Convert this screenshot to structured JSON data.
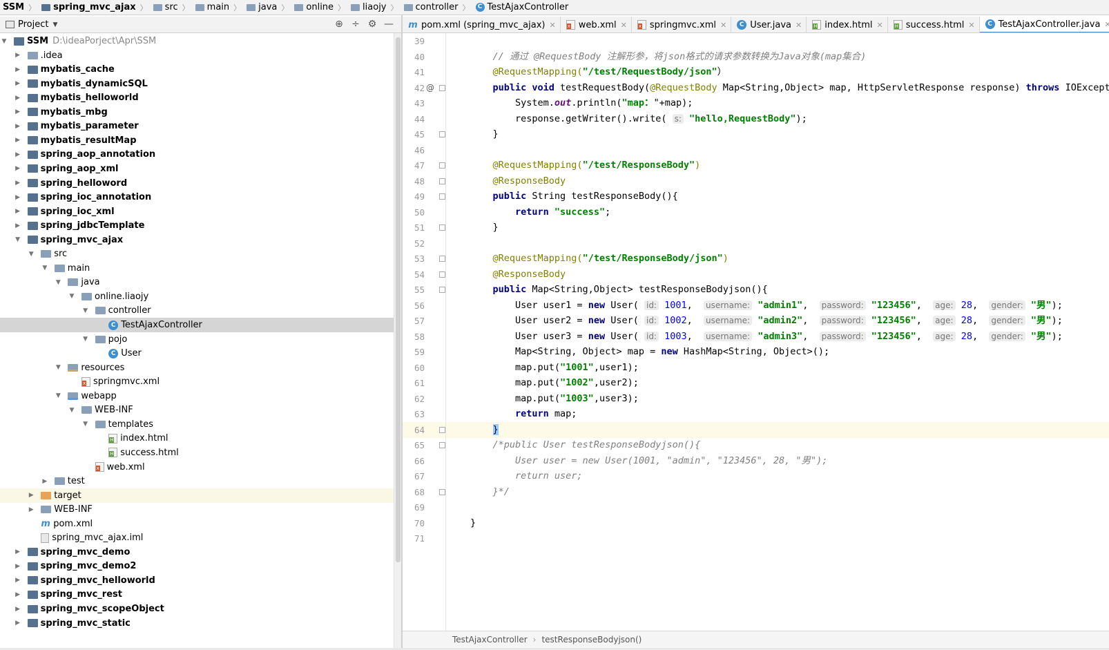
{
  "navbar": {
    "crumbs": [
      {
        "label": "SSM",
        "bold": true,
        "icon": "none"
      },
      {
        "label": "spring_mvc_ajax",
        "bold": true,
        "icon": "module"
      },
      {
        "label": "src",
        "icon": "folder"
      },
      {
        "label": "main",
        "icon": "folder"
      },
      {
        "label": "java",
        "icon": "folder"
      },
      {
        "label": "online",
        "icon": "folder"
      },
      {
        "label": "liaojy",
        "icon": "folder"
      },
      {
        "label": "controller",
        "icon": "folder"
      },
      {
        "label": "TestAjaxController",
        "icon": "class"
      }
    ]
  },
  "project": {
    "title": "Project",
    "tools": [
      "⊕",
      "÷",
      "⚙",
      "—"
    ]
  },
  "tree": [
    {
      "depth": 0,
      "arrow": "open",
      "icon": "module",
      "label": "SSM",
      "bold": true,
      "path": "D:\\ideaPorject\\Apr\\SSM"
    },
    {
      "depth": 1,
      "arrow": "closed",
      "icon": "folder",
      "label": ".idea"
    },
    {
      "depth": 1,
      "arrow": "closed",
      "icon": "module",
      "label": "mybatis_cache",
      "bold": true
    },
    {
      "depth": 1,
      "arrow": "closed",
      "icon": "module",
      "label": "mybatis_dynamicSQL",
      "bold": true
    },
    {
      "depth": 1,
      "arrow": "closed",
      "icon": "module",
      "label": "mybatis_helloworld",
      "bold": true
    },
    {
      "depth": 1,
      "arrow": "closed",
      "icon": "module",
      "label": "mybatis_mbg",
      "bold": true
    },
    {
      "depth": 1,
      "arrow": "closed",
      "icon": "module",
      "label": "mybatis_parameter",
      "bold": true
    },
    {
      "depth": 1,
      "arrow": "closed",
      "icon": "module",
      "label": "mybatis_resultMap",
      "bold": true
    },
    {
      "depth": 1,
      "arrow": "closed",
      "icon": "module",
      "label": "spring_aop_annotation",
      "bold": true
    },
    {
      "depth": 1,
      "arrow": "closed",
      "icon": "module",
      "label": "spring_aop_xml",
      "bold": true
    },
    {
      "depth": 1,
      "arrow": "closed",
      "icon": "module",
      "label": "spring_helloword",
      "bold": true
    },
    {
      "depth": 1,
      "arrow": "closed",
      "icon": "module",
      "label": "spring_ioc_annotation",
      "bold": true
    },
    {
      "depth": 1,
      "arrow": "closed",
      "icon": "module",
      "label": "spring_ioc_xml",
      "bold": true
    },
    {
      "depth": 1,
      "arrow": "closed",
      "icon": "module",
      "label": "spring_jdbcTemplate",
      "bold": true
    },
    {
      "depth": 1,
      "arrow": "open",
      "icon": "module",
      "label": "spring_mvc_ajax",
      "bold": true
    },
    {
      "depth": 2,
      "arrow": "open",
      "icon": "folder",
      "label": "src"
    },
    {
      "depth": 3,
      "arrow": "open",
      "icon": "folder",
      "label": "main"
    },
    {
      "depth": 4,
      "arrow": "open",
      "icon": "folder",
      "label": "java"
    },
    {
      "depth": 5,
      "arrow": "open",
      "icon": "folder",
      "label": "online.liaojy"
    },
    {
      "depth": 6,
      "arrow": "open",
      "icon": "folder",
      "label": "controller"
    },
    {
      "depth": 7,
      "arrow": "none",
      "icon": "class",
      "label": "TestAjaxController",
      "selected": true
    },
    {
      "depth": 6,
      "arrow": "open",
      "icon": "folder",
      "label": "pojo"
    },
    {
      "depth": 7,
      "arrow": "none",
      "icon": "class",
      "label": "User"
    },
    {
      "depth": 4,
      "arrow": "open",
      "icon": "res",
      "label": "resources"
    },
    {
      "depth": 5,
      "arrow": "none",
      "icon": "xml",
      "label": "springmvc.xml"
    },
    {
      "depth": 4,
      "arrow": "open",
      "icon": "web",
      "label": "webapp"
    },
    {
      "depth": 5,
      "arrow": "open",
      "icon": "folder",
      "label": "WEB-INF"
    },
    {
      "depth": 6,
      "arrow": "open",
      "icon": "folder",
      "label": "templates"
    },
    {
      "depth": 7,
      "arrow": "none",
      "icon": "html",
      "label": "index.html"
    },
    {
      "depth": 7,
      "arrow": "none",
      "icon": "html",
      "label": "success.html"
    },
    {
      "depth": 6,
      "arrow": "none",
      "icon": "xml",
      "label": "web.xml"
    },
    {
      "depth": 3,
      "arrow": "closed",
      "icon": "folder",
      "label": "test"
    },
    {
      "depth": 2,
      "arrow": "closed",
      "icon": "target",
      "label": "target",
      "highlight": true
    },
    {
      "depth": 2,
      "arrow": "closed",
      "icon": "folder",
      "label": "WEB-INF"
    },
    {
      "depth": 2,
      "arrow": "none",
      "icon": "mvn",
      "label": "pom.xml"
    },
    {
      "depth": 2,
      "arrow": "none",
      "icon": "iml",
      "label": "spring_mvc_ajax.iml"
    },
    {
      "depth": 1,
      "arrow": "closed",
      "icon": "module",
      "label": "spring_mvc_demo",
      "bold": true
    },
    {
      "depth": 1,
      "arrow": "closed",
      "icon": "module",
      "label": "spring_mvc_demo2",
      "bold": true
    },
    {
      "depth": 1,
      "arrow": "closed",
      "icon": "module",
      "label": "spring_mvc_helloworld",
      "bold": true
    },
    {
      "depth": 1,
      "arrow": "closed",
      "icon": "module",
      "label": "spring_mvc_rest",
      "bold": true
    },
    {
      "depth": 1,
      "arrow": "closed",
      "icon": "module",
      "label": "spring_mvc_scopeObject",
      "bold": true
    },
    {
      "depth": 1,
      "arrow": "closed",
      "icon": "module",
      "label": "spring_mvc_static",
      "bold": true
    }
  ],
  "tabs": [
    {
      "label": "pom.xml (spring_mvc_ajax)",
      "icon": "mvn"
    },
    {
      "label": "web.xml",
      "icon": "xml"
    },
    {
      "label": "springmvc.xml",
      "icon": "xml"
    },
    {
      "label": "User.java",
      "icon": "class"
    },
    {
      "label": "index.html",
      "icon": "html"
    },
    {
      "label": "success.html",
      "icon": "html"
    },
    {
      "label": "TestAjaxController.java",
      "icon": "class",
      "active": true
    }
  ],
  "code": [
    {
      "n": "39",
      "t": []
    },
    {
      "n": "40",
      "t": [
        [
          "cm",
          "    // 通过 @RequestBody 注解形参，将json格式的请求参数转换为Java对象(map集合)"
        ]
      ]
    },
    {
      "n": "41",
      "t": [
        [
          "ann",
          "    @RequestMapping("
        ],
        [
          "str",
          "\"/test/RequestBody/json\""
        ],
        [
          "",
          "）"
        ]
      ]
    },
    {
      "n": "42",
      "at": true,
      "fold": true,
      "t": [
        [
          "kw",
          "    public void "
        ],
        [
          "",
          "testRequestBody("
        ],
        [
          "ann",
          "@RequestBody"
        ],
        [
          "",
          " Map<String,Object> map, HttpServletResponse response) "
        ],
        [
          "kw",
          "throws"
        ],
        [
          "",
          " IOException {"
        ]
      ]
    },
    {
      "n": "43",
      "t": [
        [
          "",
          "        System."
        ],
        [
          "fld",
          "out"
        ],
        [
          "",
          ".println("
        ],
        [
          "str",
          "\"map："
        ],
        [
          "",
          "\"+map);"
        ]
      ]
    },
    {
      "n": "44",
      "t": [
        [
          "",
          "        response.getWriter().write( "
        ],
        [
          "hint",
          "s:"
        ],
        [
          "str",
          " \"hello,RequestBody\""
        ],
        [
          "",
          ");"
        ]
      ]
    },
    {
      "n": "45",
      "fold": true,
      "t": [
        [
          "",
          "    }"
        ]
      ]
    },
    {
      "n": "46",
      "t": []
    },
    {
      "n": "47",
      "fold": true,
      "t": [
        [
          "ann",
          "    @RequestMapping("
        ],
        [
          "str",
          "\"/test/ResponseBody\""
        ],
        [
          "ann",
          ")"
        ]
      ]
    },
    {
      "n": "48",
      "fold": true,
      "t": [
        [
          "ann",
          "    @ResponseBody"
        ]
      ]
    },
    {
      "n": "49",
      "fold": true,
      "t": [
        [
          "kw",
          "    public "
        ],
        [
          "",
          "String testResponseBody(){"
        ]
      ]
    },
    {
      "n": "50",
      "t": [
        [
          "kw",
          "        return "
        ],
        [
          "str",
          "\"success\""
        ],
        [
          "",
          ";"
        ]
      ]
    },
    {
      "n": "51",
      "fold": true,
      "t": [
        [
          "",
          "    }"
        ]
      ]
    },
    {
      "n": "52",
      "t": []
    },
    {
      "n": "53",
      "fold": true,
      "t": [
        [
          "ann",
          "    @RequestMapping("
        ],
        [
          "str",
          "\"/test/ResponseBody/json\""
        ],
        [
          "ann",
          ")"
        ]
      ]
    },
    {
      "n": "54",
      "fold": true,
      "t": [
        [
          "ann",
          "    @ResponseBody"
        ]
      ]
    },
    {
      "n": "55",
      "fold": true,
      "t": [
        [
          "kw",
          "    public "
        ],
        [
          "",
          "Map<String,Object> testResponseBodyjson(){"
        ]
      ]
    },
    {
      "n": "56",
      "t": [
        [
          "",
          "        User user1 = "
        ],
        [
          "kw",
          "new "
        ],
        [
          "",
          "User( "
        ],
        [
          "hint",
          "id:"
        ],
        [
          "num",
          " 1001"
        ],
        [
          "",
          ",  "
        ],
        [
          "hint",
          "username:"
        ],
        [
          "str",
          " \"admin1\""
        ],
        [
          "",
          ",  "
        ],
        [
          "hint",
          "password:"
        ],
        [
          "str",
          " \"123456\""
        ],
        [
          "",
          ",  "
        ],
        [
          "hint",
          "age:"
        ],
        [
          "num",
          " 28"
        ],
        [
          "",
          ",  "
        ],
        [
          "hint",
          "gender:"
        ],
        [
          "str",
          " \"男\""
        ],
        [
          "",
          ");"
        ]
      ]
    },
    {
      "n": "57",
      "t": [
        [
          "",
          "        User user2 = "
        ],
        [
          "kw",
          "new "
        ],
        [
          "",
          "User( "
        ],
        [
          "hint",
          "id:"
        ],
        [
          "num",
          " 1002"
        ],
        [
          "",
          ",  "
        ],
        [
          "hint",
          "username:"
        ],
        [
          "str",
          " \"admin2\""
        ],
        [
          "",
          ",  "
        ],
        [
          "hint",
          "password:"
        ],
        [
          "str",
          " \"123456\""
        ],
        [
          "",
          ",  "
        ],
        [
          "hint",
          "age:"
        ],
        [
          "num",
          " 28"
        ],
        [
          "",
          ",  "
        ],
        [
          "hint",
          "gender:"
        ],
        [
          "str",
          " \"男\""
        ],
        [
          "",
          ");"
        ]
      ]
    },
    {
      "n": "58",
      "t": [
        [
          "",
          "        User user3 = "
        ],
        [
          "kw",
          "new "
        ],
        [
          "",
          "User( "
        ],
        [
          "hint",
          "id:"
        ],
        [
          "num",
          " 1003"
        ],
        [
          "",
          ",  "
        ],
        [
          "hint",
          "username:"
        ],
        [
          "str",
          " \"admin3\""
        ],
        [
          "",
          ",  "
        ],
        [
          "hint",
          "password:"
        ],
        [
          "str",
          " \"123456\""
        ],
        [
          "",
          ",  "
        ],
        [
          "hint",
          "age:"
        ],
        [
          "num",
          " 28"
        ],
        [
          "",
          ",  "
        ],
        [
          "hint",
          "gender:"
        ],
        [
          "str",
          " \"男\""
        ],
        [
          "",
          ");"
        ]
      ]
    },
    {
      "n": "59",
      "t": [
        [
          "",
          "        Map<String, Object> map = "
        ],
        [
          "kw",
          "new "
        ],
        [
          "",
          "HashMap<String, Object>();"
        ]
      ]
    },
    {
      "n": "60",
      "t": [
        [
          "",
          "        map.put("
        ],
        [
          "str",
          "\"1001\""
        ],
        [
          "",
          ",user1);"
        ]
      ]
    },
    {
      "n": "61",
      "t": [
        [
          "",
          "        map.put("
        ],
        [
          "str",
          "\"1002\""
        ],
        [
          "",
          ",user2);"
        ]
      ]
    },
    {
      "n": "62",
      "t": [
        [
          "",
          "        map.put("
        ],
        [
          "str",
          "\"1003\""
        ],
        [
          "",
          ",user3);"
        ]
      ]
    },
    {
      "n": "63",
      "t": [
        [
          "kw",
          "        return "
        ],
        [
          "",
          "map;"
        ]
      ]
    },
    {
      "n": "64",
      "fold": true,
      "cur": true,
      "t": [
        [
          "",
          "    "
        ],
        [
          "brace",
          "}"
        ]
      ]
    },
    {
      "n": "65",
      "fold": true,
      "t": [
        [
          "cm",
          "    /*public User testResponseBodyjson(){"
        ]
      ]
    },
    {
      "n": "66",
      "t": [
        [
          "cm",
          "        User user = new User(1001, \"admin\", \"123456\", 28, \"男\");"
        ]
      ]
    },
    {
      "n": "67",
      "t": [
        [
          "cm",
          "        return user;"
        ]
      ]
    },
    {
      "n": "68",
      "fold": true,
      "t": [
        [
          "cm",
          "    }*/"
        ]
      ]
    },
    {
      "n": "69",
      "t": []
    },
    {
      "n": "70",
      "t": [
        [
          "",
          "}"
        ]
      ]
    },
    {
      "n": "71",
      "t": []
    }
  ],
  "status": {
    "items": [
      "TestAjaxController",
      "testResponseBodyjson()"
    ]
  }
}
